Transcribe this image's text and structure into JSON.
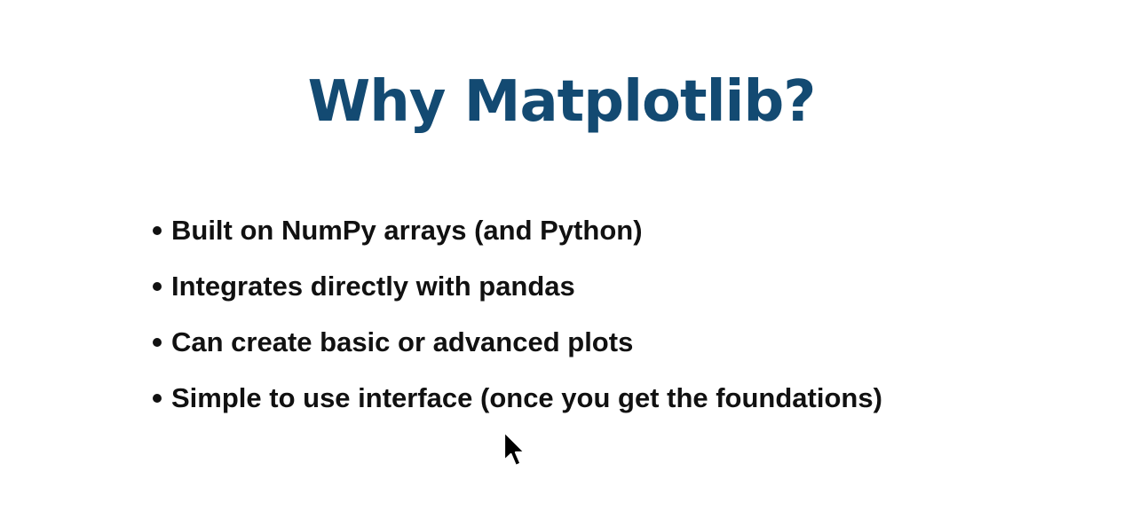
{
  "slide": {
    "title": "Why Matplotlib?",
    "bullets": [
      "Built on NumPy arrays (and Python)",
      "Integrates directly with pandas",
      "Can create basic or advanced plots",
      "Simple to use interface (once you get the foundations)"
    ]
  },
  "colors": {
    "title": "#134a72",
    "text": "#111111",
    "background": "#ffffff"
  },
  "icons": {
    "pointer": "mouse-pointer-icon"
  }
}
